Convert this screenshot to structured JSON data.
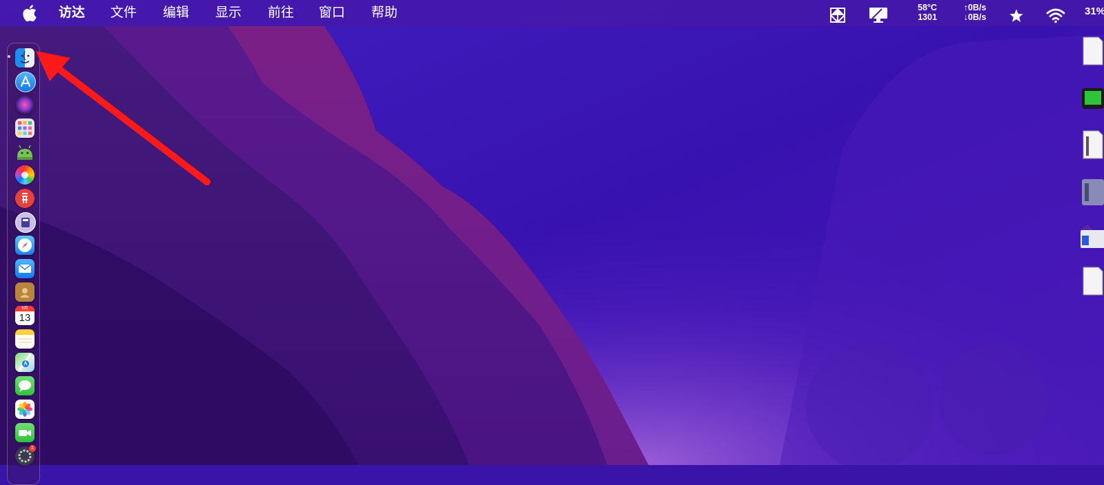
{
  "menubar": {
    "apple_icon": "apple-logo-icon",
    "items": [
      "访达",
      "文件",
      "编辑",
      "显示",
      "前往",
      "窗口",
      "帮助"
    ],
    "status": {
      "temperature": "58°C",
      "fan_rpm": "1301",
      "upload_rate": "↑0B/s",
      "download_rate": "↓0B/s",
      "battery_percent": "31%"
    }
  },
  "dock": {
    "apps": [
      {
        "name": "Finder",
        "icon": "finder-icon",
        "running": true
      },
      {
        "name": "App Store",
        "icon": "app-store-icon"
      },
      {
        "name": "Siri",
        "icon": "siri-icon"
      },
      {
        "name": "Launchpad",
        "icon": "launchpad-icon"
      },
      {
        "name": "Android",
        "icon": "android-icon"
      },
      {
        "name": "Color Picker",
        "icon": "color-wheel-icon"
      },
      {
        "name": "Red App",
        "icon": "red-app-icon"
      },
      {
        "name": "Utility",
        "icon": "utility-icon"
      },
      {
        "name": "Safari",
        "icon": "safari-icon"
      },
      {
        "name": "Mail",
        "icon": "mail-icon"
      },
      {
        "name": "Contacts",
        "icon": "contacts-icon"
      },
      {
        "name": "Calendar",
        "icon": "calendar-icon",
        "day": "13",
        "month": "6月"
      },
      {
        "name": "Notes",
        "icon": "notes-icon"
      },
      {
        "name": "Maps",
        "icon": "maps-icon"
      },
      {
        "name": "Messages",
        "icon": "messages-icon"
      },
      {
        "name": "Photos",
        "icon": "photos-icon"
      },
      {
        "name": "FaceTime",
        "icon": "facetime-icon"
      },
      {
        "name": "System",
        "icon": "settings-icon",
        "badge": "1"
      }
    ]
  },
  "colors": {
    "wallpaper_top": "#3c18b8",
    "wallpaper_dark": "#2a0a5c",
    "annotation_arrow": "#ff1a1a"
  }
}
